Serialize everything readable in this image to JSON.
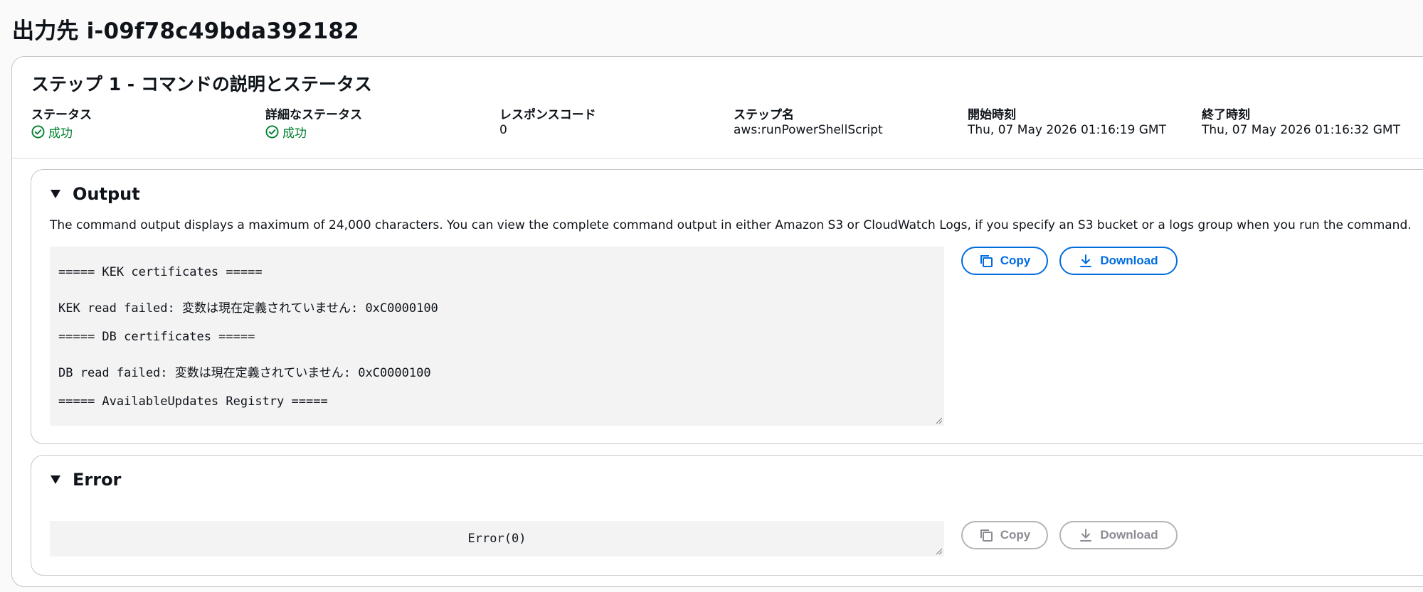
{
  "page_title": "出力先 i-09f78c49bda392182",
  "step": {
    "title": "ステップ 1 - コマンドの説明とステータス",
    "fields": {
      "status": {
        "label": "ステータス",
        "value": "成功"
      },
      "detailed_status": {
        "label": "詳細なステータス",
        "value": "成功"
      },
      "response_code": {
        "label": "レスポンスコード",
        "value": "0"
      },
      "step_name": {
        "label": "ステップ名",
        "value": "aws:runPowerShellScript"
      },
      "start_time": {
        "label": "開始時刻",
        "value": "Thu, 07 May 2026 01:16:19 GMT"
      },
      "end_time": {
        "label": "終了時刻",
        "value": "Thu, 07 May 2026 01:16:32 GMT"
      }
    }
  },
  "output": {
    "title": "Output",
    "description": "The command output displays a maximum of 24,000 characters. You can view the complete command output in either Amazon S3 or CloudWatch Logs, if you specify an S3 bucket or a logs group when you run the command.",
    "lines": [
      "===== KEK certificates =====",
      "KEK read failed: 変数は現在定義されていません: 0xC0000100",
      "===== DB certificates =====",
      "DB read failed: 変数は現在定義されていません: 0xC0000100",
      "===== AvailableUpdates Registry ====="
    ],
    "copy_label": "Copy",
    "download_label": "Download"
  },
  "error": {
    "title": "Error",
    "text": "Error(0)",
    "copy_label": "Copy",
    "download_label": "Download"
  },
  "colors": {
    "accent": "#006ce0",
    "success": "#00802f",
    "disabled": "#8c8c94"
  },
  "icons": [
    "check-circle-icon",
    "caret-down-icon",
    "copy-icon",
    "download-icon",
    "resize-handle-icon"
  ]
}
